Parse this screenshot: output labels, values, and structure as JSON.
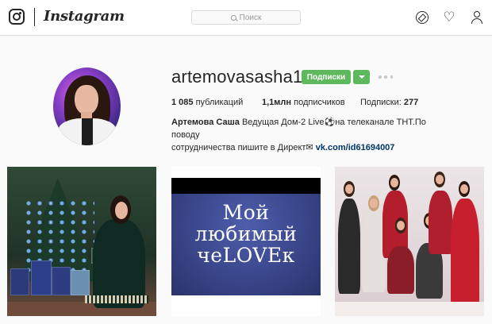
{
  "app": {
    "wordmark": "Instagram"
  },
  "nav": {
    "search_placeholder": "Поиск",
    "icons": [
      "instagram-camera-icon",
      "compass-icon",
      "heart-icon",
      "person-icon"
    ]
  },
  "profile": {
    "username": "artemovasasha1",
    "follow_label": "Подписки",
    "stats": {
      "posts_count": "1 085",
      "posts_label": "публикаций",
      "followers_count": "1,1млн",
      "followers_label": "подписчиков",
      "following_label": "Подписки:",
      "following_count": "277"
    },
    "bio": {
      "name": "Артемова Саша",
      "text_1": "Ведущая Дом-2 Live⚽на телеканале ТНТ.По поводу",
      "text_2": "сотрудничества пишите в Директ✉",
      "link": "vk.com/id61694007"
    }
  },
  "posts": {
    "post_2_text": [
      "Мой",
      "любимый",
      "чеLOVEк"
    ]
  },
  "colors": {
    "follow_green": "#5eb85e",
    "link_blue": "#003569",
    "background": "#fafafa"
  }
}
